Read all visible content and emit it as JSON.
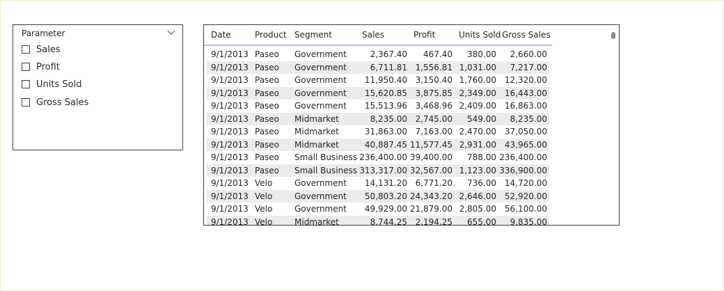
{
  "parameter_slicer": {
    "title": "Parameter",
    "options": [
      {
        "label": "Sales",
        "checked": false
      },
      {
        "label": "Profit",
        "checked": false
      },
      {
        "label": "Units Sold",
        "checked": false
      },
      {
        "label": "Gross Sales",
        "checked": false
      }
    ]
  },
  "table": {
    "columns": [
      "Date",
      "Product",
      "Segment",
      "Sales",
      "Profit",
      "Units Sold",
      "Gross Sales"
    ],
    "rows": [
      [
        "9/1/2013",
        "Paseo",
        "Government",
        "2,367.40",
        "467.40",
        "380.00",
        "2,660.00"
      ],
      [
        "9/1/2013",
        "Paseo",
        "Government",
        "6,711.81",
        "1,556.81",
        "1,031.00",
        "7,217.00"
      ],
      [
        "9/1/2013",
        "Paseo",
        "Government",
        "11,950.40",
        "3,150.40",
        "1,760.00",
        "12,320.00"
      ],
      [
        "9/1/2013",
        "Paseo",
        "Government",
        "15,620.85",
        "3,875.85",
        "2,349.00",
        "16,443.00"
      ],
      [
        "9/1/2013",
        "Paseo",
        "Government",
        "15,513.96",
        "3,468.96",
        "2,409.00",
        "16,863.00"
      ],
      [
        "9/1/2013",
        "Paseo",
        "Midmarket",
        "8,235.00",
        "2,745.00",
        "549.00",
        "8,235.00"
      ],
      [
        "9/1/2013",
        "Paseo",
        "Midmarket",
        "31,863.00",
        "7,163.00",
        "2,470.00",
        "37,050.00"
      ],
      [
        "9/1/2013",
        "Paseo",
        "Midmarket",
        "40,887.45",
        "11,577.45",
        "2,931.00",
        "43,965.00"
      ],
      [
        "9/1/2013",
        "Paseo",
        "Small Business",
        "236,400.00",
        "39,400.00",
        "788.00",
        "236,400.00"
      ],
      [
        "9/1/2013",
        "Paseo",
        "Small Business",
        "313,317.00",
        "32,567.00",
        "1,123.00",
        "336,900.00"
      ],
      [
        "9/1/2013",
        "Velo",
        "Government",
        "14,131.20",
        "6,771.20",
        "736.00",
        "14,720.00"
      ],
      [
        "9/1/2013",
        "Velo",
        "Government",
        "50,803.20",
        "24,343.20",
        "2,646.00",
        "52,920.00"
      ],
      [
        "9/1/2013",
        "Velo",
        "Government",
        "49,929.00",
        "21,879.00",
        "2,805.00",
        "56,100.00"
      ],
      [
        "9/1/2013",
        "Velo",
        "Midmarket",
        "8,744.25",
        "2,194.25",
        "655.00",
        "9,835.00"
      ]
    ]
  },
  "colors": {
    "border": "#3c3c3c",
    "row_alt": "#ebebeb",
    "header_underline": "#a9c5e0",
    "canvas_border": "#eef0cc"
  }
}
